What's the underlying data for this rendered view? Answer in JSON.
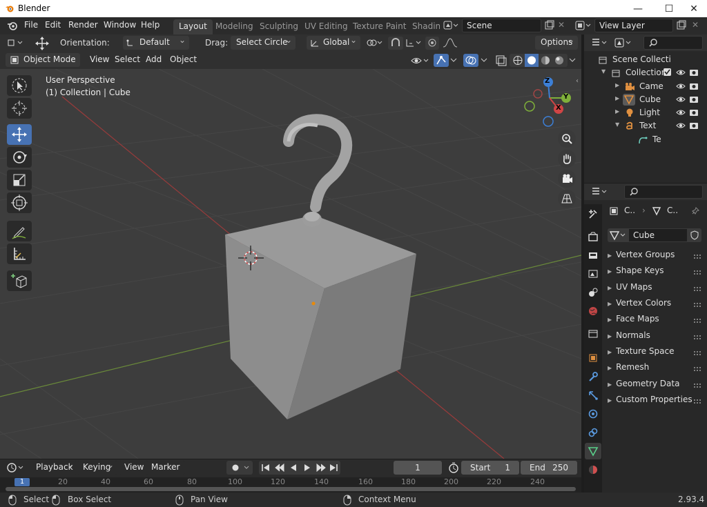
{
  "window": {
    "title": "Blender",
    "min": "—",
    "max": "☐",
    "close": "✕"
  },
  "menu": {
    "file": "File",
    "edit": "Edit",
    "render": "Render",
    "window": "Window",
    "help": "Help"
  },
  "workspaces": [
    "Layout",
    "Modeling",
    "Sculpting",
    "UV Editing",
    "Texture Paint",
    "Shadin"
  ],
  "scene": {
    "name": "Scene",
    "view_layer": "View Layer"
  },
  "tool_header": {
    "orientation_label": "Orientation:",
    "orientation_value": "Default",
    "drag_label": "Drag:",
    "drag_value": "Select Circle",
    "transform_orientation": "Global",
    "options": "Options"
  },
  "viewport_header": {
    "mode": "Object Mode",
    "view": "View",
    "select": "Select",
    "add": "Add",
    "object": "Object"
  },
  "viewport_overlay": {
    "perspective": "User Perspective",
    "context": "(1) Collection | Cube"
  },
  "gizmo": {
    "x": "X",
    "y": "Y",
    "z": "Z"
  },
  "outliner": {
    "root": "Scene Collecti",
    "collection": "Collection",
    "items": [
      {
        "label": "Came",
        "icon": "camera-icon"
      },
      {
        "label": "Cube",
        "icon": "mesh-icon"
      },
      {
        "label": "Light",
        "icon": "light-icon"
      },
      {
        "label": "Text",
        "icon": "text-icon"
      }
    ],
    "sub_item": "Te"
  },
  "properties": {
    "breadcrumb_a": "C..",
    "breadcrumb_b": "C..",
    "data_name": "Cube",
    "panels": [
      "Vertex Groups",
      "Shape Keys",
      "UV Maps",
      "Vertex Colors",
      "Face Maps",
      "Normals",
      "Texture Space",
      "Remesh",
      "Geometry Data",
      "Custom Properties"
    ]
  },
  "timeline": {
    "playback": "Playback",
    "keying": "Keying",
    "view": "View",
    "marker": "Marker",
    "current_frame": "1",
    "start_label": "Start",
    "start_value": "1",
    "end_label": "End",
    "end_value": "250",
    "ruler": [
      "1",
      "20",
      "40",
      "60",
      "80",
      "100",
      "120",
      "140",
      "160",
      "180",
      "200",
      "220",
      "240"
    ]
  },
  "statusbar": {
    "select": "Select",
    "box_select": "Box Select",
    "pan_view": "Pan View",
    "context_menu": "Context Menu",
    "version": "2.93.4"
  },
  "colors": {
    "accent": "#4772b3",
    "viewport_bg": "#3d3d3d",
    "x_axis": "#d04545",
    "y_axis": "#7fb03a",
    "z_axis": "#3c7fd6"
  }
}
